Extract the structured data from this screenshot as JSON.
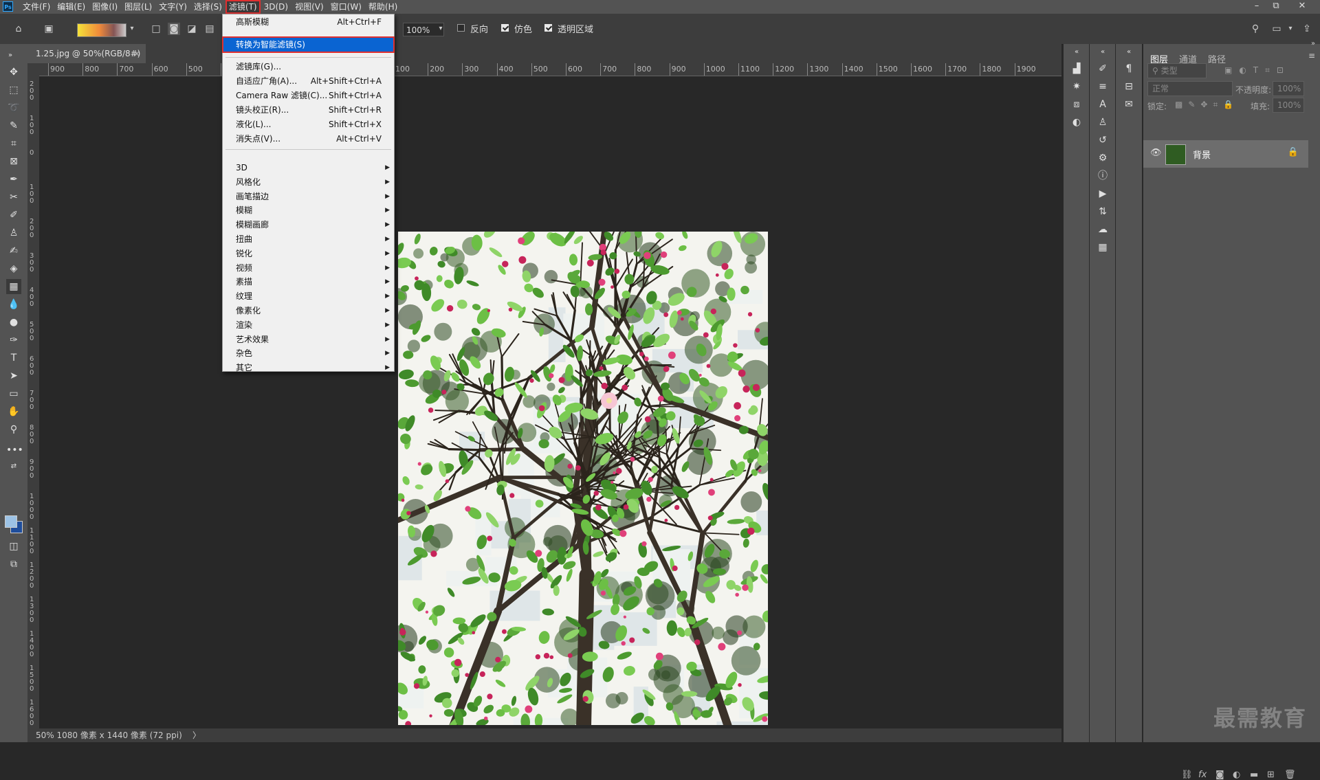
{
  "app": {
    "logo": "Ps",
    "menu": [
      "文件(F)",
      "编辑(E)",
      "图像(I)",
      "图层(L)",
      "文字(Y)",
      "选择(S)",
      "滤镜(T)",
      "3D(D)",
      "视图(V)",
      "窗口(W)",
      "帮助(H)"
    ],
    "active_menu": "滤镜(T)",
    "window_controls": [
      "–",
      "⧉",
      "✕"
    ]
  },
  "options_bar": {
    "zoom": "100%",
    "checkboxes": [
      {
        "label": "反向",
        "checked": false
      },
      {
        "label": "仿色",
        "checked": true
      },
      {
        "label": "透明区域",
        "checked": true
      }
    ]
  },
  "document": {
    "tab_title": "1.25.jpg @ 50%(RGB/8#)",
    "tab_close": "×",
    "status": "50%   1080 像素 x 1440 像素 (72 ppi)",
    "status_arrow": "〉"
  },
  "ruler": {
    "h_ticks": [
      "900",
      "800",
      "700",
      "600",
      "500",
      "",
      "",
      "",
      "",
      "",
      "100",
      "200",
      "300",
      "400",
      "500",
      "600",
      "700",
      "800",
      "900",
      "1000",
      "1100",
      "1200",
      "1300",
      "1400",
      "1500",
      "1600",
      "1700",
      "1800",
      "1900"
    ],
    "v_ticks": [
      "200",
      "100",
      "0",
      "100",
      "200",
      "300",
      "400",
      "500",
      "600",
      "700",
      "800",
      "900",
      "1000",
      "1100",
      "1200",
      "1300",
      "1400",
      "1500",
      "1600"
    ]
  },
  "filter_menu": {
    "top_items": [
      {
        "label": "高斯模糊",
        "shortcut": "Alt+Ctrl+F"
      }
    ],
    "highlighted": {
      "label": "转换为智能滤镜(S)"
    },
    "mid_items": [
      {
        "label": "滤镜库(G)...",
        "shortcut": ""
      },
      {
        "label": "自适应广角(A)...",
        "shortcut": "Alt+Shift+Ctrl+A"
      },
      {
        "label": "Camera Raw 滤镜(C)...",
        "shortcut": "Shift+Ctrl+A"
      },
      {
        "label": "镜头校正(R)...",
        "shortcut": "Shift+Ctrl+R"
      },
      {
        "label": "液化(L)...",
        "shortcut": "Shift+Ctrl+X"
      },
      {
        "label": "消失点(V)...",
        "shortcut": "Alt+Ctrl+V"
      }
    ],
    "submenus": [
      "3D",
      "风格化",
      "画笔描边",
      "模糊",
      "模糊画廊",
      "扭曲",
      "锐化",
      "视频",
      "素描",
      "纹理",
      "像素化",
      "渲染",
      "艺术效果",
      "杂色",
      "其它"
    ]
  },
  "layers_panel": {
    "tabs": [
      "图层",
      "通道",
      "路径"
    ],
    "filter_placeholder": "类型",
    "blend_mode": "正常",
    "opacity_label": "不透明度:",
    "opacity_value": "100%",
    "lock_label": "锁定:",
    "fill_label": "填充:",
    "fill_value": "100%",
    "layer_name": "背景"
  },
  "watermark": "最需教育"
}
